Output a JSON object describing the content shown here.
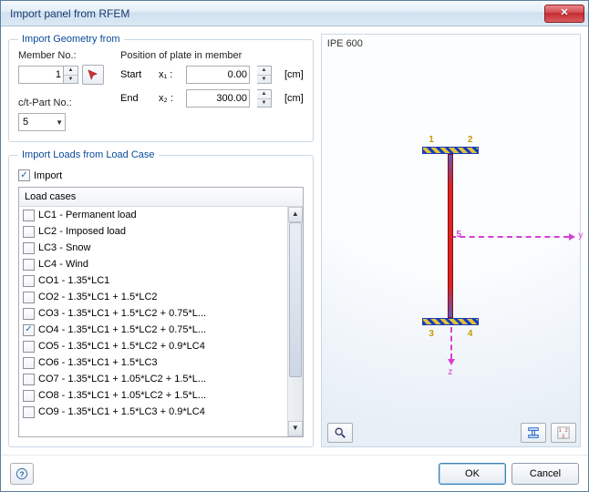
{
  "window": {
    "title": "Import panel from RFEM"
  },
  "geometry": {
    "legend": "Import Geometry from",
    "member_no_label": "Member No.:",
    "member_no_value": "1",
    "ct_part_label": "c/t-Part No.:",
    "ct_part_value": "5",
    "plate_pos_label": "Position of plate in member",
    "start_label": "Start",
    "end_label": "End",
    "x1_label": "x₁ :",
    "x2_label": "x₂ :",
    "x1_value": "0.00",
    "x2_value": "300.00",
    "unit": "[cm]"
  },
  "loads": {
    "legend": "Import Loads from Load Case",
    "import_label": "Import",
    "import_checked": true,
    "header": "Load cases",
    "items": [
      {
        "checked": false,
        "label": "LC1 - Permanent load"
      },
      {
        "checked": false,
        "label": "LC2 - Imposed load"
      },
      {
        "checked": false,
        "label": "LC3 - Snow"
      },
      {
        "checked": false,
        "label": "LC4 - Wind"
      },
      {
        "checked": false,
        "label": "CO1 - 1.35*LC1"
      },
      {
        "checked": false,
        "label": "CO2 - 1.35*LC1 + 1.5*LC2"
      },
      {
        "checked": false,
        "label": "CO3 - 1.35*LC1 + 1.5*LC2 + 0.75*L..."
      },
      {
        "checked": true,
        "label": "CO4 - 1.35*LC1 + 1.5*LC2 + 0.75*L..."
      },
      {
        "checked": false,
        "label": "CO5 - 1.35*LC1 + 1.5*LC2 + 0.9*LC4"
      },
      {
        "checked": false,
        "label": "CO6 - 1.35*LC1 + 1.5*LC3"
      },
      {
        "checked": false,
        "label": "CO7 - 1.35*LC1 + 1.05*LC2 + 1.5*L..."
      },
      {
        "checked": false,
        "label": "CO8 - 1.35*LC1 + 1.05*LC2 + 1.5*L..."
      },
      {
        "checked": false,
        "label": "CO9 - 1.35*LC1 + 1.5*LC3 + 0.9*LC4"
      }
    ]
  },
  "preview": {
    "section_label": "IPE 600",
    "flange_nums": {
      "tl": "1",
      "tr": "2",
      "bl": "3",
      "br": "4"
    },
    "web_num": "5",
    "y_axis": "y",
    "z_axis": "z"
  },
  "buttons": {
    "ok": "OK",
    "cancel": "Cancel"
  }
}
